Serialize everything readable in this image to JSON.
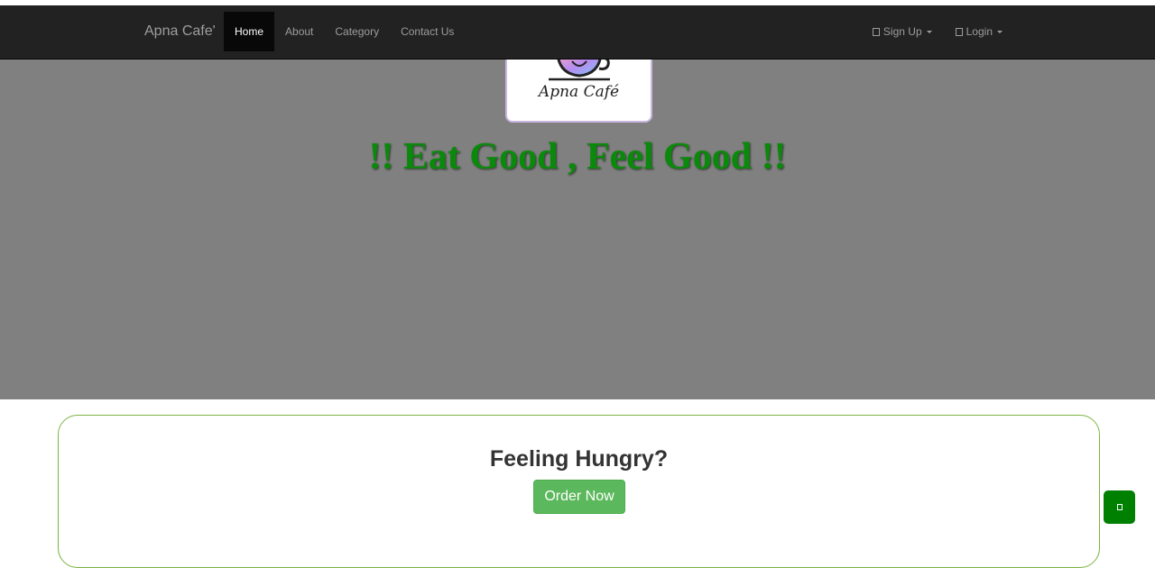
{
  "navbar": {
    "brand": "Apna Cafe'",
    "items": [
      {
        "label": "Home",
        "active": true
      },
      {
        "label": "About"
      },
      {
        "label": "Category"
      },
      {
        "label": "Contact Us"
      }
    ],
    "right": [
      {
        "label": "Sign Up",
        "icon": "user-icon"
      },
      {
        "label": "Login",
        "icon": "login-icon"
      }
    ]
  },
  "hero": {
    "logo_text": "Apna Café",
    "tagline": "!! Eat Good , Feel Good !!"
  },
  "order": {
    "title": "Feeling Hungry?",
    "button": "Order Now"
  },
  "floating_button": {
    "icon": "chat-icon"
  },
  "colors": {
    "navbar": "#222222",
    "hero_bg": "#808080",
    "tagline": "#0a8a0a",
    "order_button": "#5cb85c",
    "card_border": "#7cb342",
    "floating_button": "#008000"
  }
}
